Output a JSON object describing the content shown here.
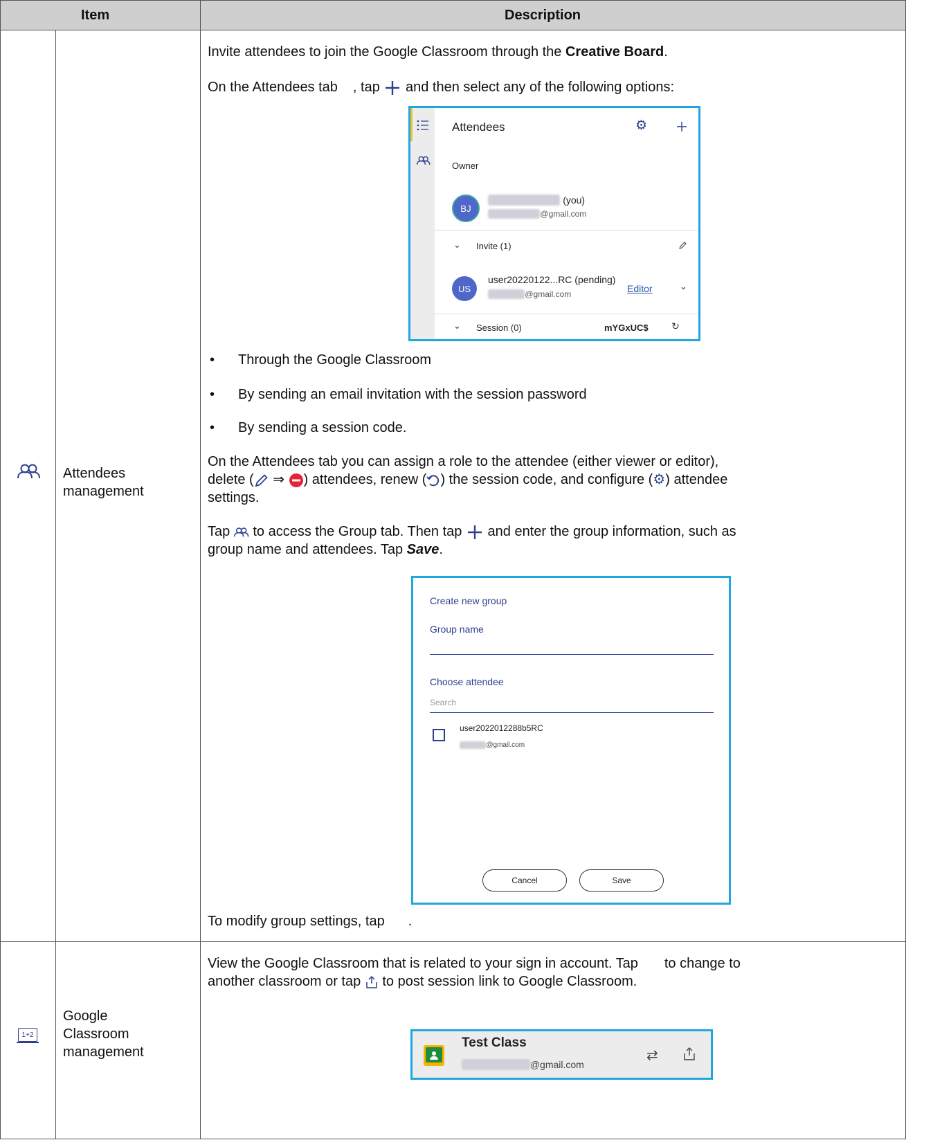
{
  "header": {
    "item": "Item",
    "description": "Description"
  },
  "rows": [
    {
      "item_label_1": "Attendees",
      "item_label_2": "management",
      "intro_pre": "Invite attendees to join the Google Classroom through the ",
      "intro_bold": "Creative Board",
      "intro_post": ".",
      "tab_line_pre": "On the Attendees tab",
      "tab_line_mid": ", tap",
      "tab_line_post": "and then select any of the following options:",
      "attendees_panel": {
        "title": "Attendees",
        "owner_label": "Owner",
        "owner_initials": "BJ",
        "owner_name_tail": "(you)",
        "owner_email_tail": "@gmail.com",
        "invite_label": "Invite (1)",
        "invitee_initials": "US",
        "invitee_name": "user20220122...RC (pending)",
        "invitee_role": "Editor",
        "invitee_email_tail": "@gmail.com",
        "session_label": "Session (0)",
        "session_code": "mYGxUC$"
      },
      "bullets": [
        "Through the Google Classroom",
        "By sending an email invitation with the session password",
        "By sending a session code."
      ],
      "roles_line1": "On the Attendees tab you can assign a role to the attendee (either viewer or editor),",
      "roles_line2_a": "delete (",
      "roles_line2_b": ") attendees, renew (",
      "roles_line2_c": ") the session code, and configure (",
      "roles_line2_d": ") attendee",
      "roles_line3": "settings.",
      "group_line1_a": "Tap",
      "group_line1_b": "to access the Group tab. Then tap",
      "group_line1_c": "and enter the group information, such as",
      "group_line2_a": "group name and attendees. Tap ",
      "group_line2_bold": "Save",
      "group_line2_c": ".",
      "group_panel": {
        "title": "Create new group",
        "group_name_label": "Group name",
        "choose_label": "Choose attendee",
        "search_placeholder": "Search",
        "user_name": "user2022012288b5RC",
        "user_email_tail": "@gmail.com",
        "cancel": "Cancel",
        "save": "Save"
      },
      "modify_line_a": "To modify group settings, tap",
      "modify_line_b": "."
    },
    {
      "item_label_1": "Google",
      "item_label_2": "Classroom",
      "item_label_3": "management",
      "icon_text": "1+2",
      "line1_a": "View the Google Classroom that is related to your sign in account. Tap",
      "line1_b": "to change to",
      "line2_a": "another classroom or tap",
      "line2_b": "to post session link to Google Classroom.",
      "classroom_panel": {
        "class_name": "Test Class",
        "email_tail": "@gmail.com"
      }
    }
  ],
  "colors": {
    "header_bg": "#cfcfcf",
    "panel_border": "#1fa8e0",
    "icon_blue": "#2f3f8f",
    "delete_red": "#e5233b"
  }
}
